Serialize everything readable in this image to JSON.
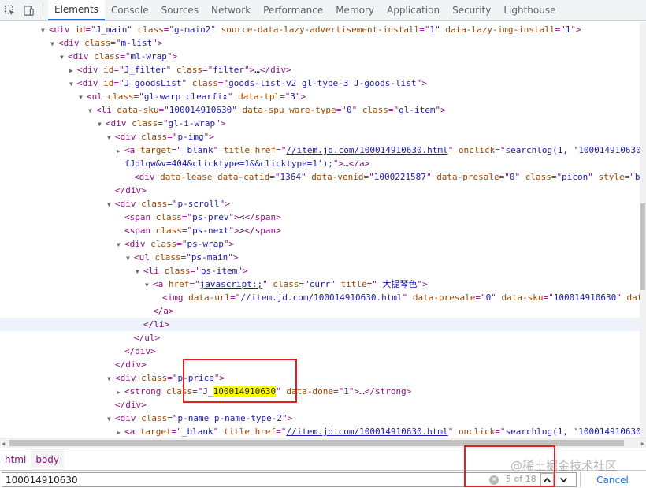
{
  "toolbar": {
    "tabs": [
      "Elements",
      "Console",
      "Sources",
      "Network",
      "Performance",
      "Memory",
      "Application",
      "Security",
      "Lighthouse"
    ],
    "active_tab": "Elements"
  },
  "tree": [
    {
      "indent": 0,
      "tri": "down",
      "segs": [
        [
          "tg",
          "<div "
        ],
        [
          "an",
          "id"
        ],
        [
          "tg",
          "=\""
        ],
        [
          "av",
          "J_main"
        ],
        [
          "tg",
          "\" "
        ],
        [
          "an",
          "class"
        ],
        [
          "tg",
          "=\""
        ],
        [
          "av",
          "g-main2"
        ],
        [
          "tg",
          "\" "
        ],
        [
          "an",
          "source-data-lazy-advertisement-install"
        ],
        [
          "tg",
          "=\""
        ],
        [
          "av",
          "1"
        ],
        [
          "tg",
          "\" "
        ],
        [
          "an",
          "data-lazy-img-install"
        ],
        [
          "tg",
          "=\""
        ],
        [
          "av",
          "1"
        ],
        [
          "tg",
          "\">"
        ]
      ]
    },
    {
      "indent": 1,
      "tri": "down",
      "segs": [
        [
          "tg",
          "<div "
        ],
        [
          "an",
          "class"
        ],
        [
          "tg",
          "=\""
        ],
        [
          "av",
          "m-list"
        ],
        [
          "tg",
          "\">"
        ]
      ]
    },
    {
      "indent": 2,
      "tri": "down",
      "segs": [
        [
          "tg",
          "<div "
        ],
        [
          "an",
          "class"
        ],
        [
          "tg",
          "=\""
        ],
        [
          "av",
          "ml-wrap"
        ],
        [
          "tg",
          "\">"
        ]
      ]
    },
    {
      "indent": 3,
      "tri": "right",
      "segs": [
        [
          "tg",
          "<div "
        ],
        [
          "an",
          "id"
        ],
        [
          "tg",
          "=\""
        ],
        [
          "av",
          "J_filter"
        ],
        [
          "tg",
          "\" "
        ],
        [
          "an",
          "class"
        ],
        [
          "tg",
          "=\""
        ],
        [
          "av",
          "filter"
        ],
        [
          "tg",
          "\">"
        ],
        [
          "txt",
          "…"
        ],
        [
          "tg",
          "</div>"
        ]
      ]
    },
    {
      "indent": 3,
      "tri": "down",
      "segs": [
        [
          "tg",
          "<div "
        ],
        [
          "an",
          "id"
        ],
        [
          "tg",
          "=\""
        ],
        [
          "av",
          "J_goodsList"
        ],
        [
          "tg",
          "\" "
        ],
        [
          "an",
          "class"
        ],
        [
          "tg",
          "=\""
        ],
        [
          "av",
          "goods-list-v2 gl-type-3 J-goods-list"
        ],
        [
          "tg",
          "\">"
        ]
      ]
    },
    {
      "indent": 4,
      "tri": "down",
      "segs": [
        [
          "tg",
          "<ul "
        ],
        [
          "an",
          "class"
        ],
        [
          "tg",
          "=\""
        ],
        [
          "av",
          "gl-warp clearfix"
        ],
        [
          "tg",
          "\" "
        ],
        [
          "an",
          "data-tpl"
        ],
        [
          "tg",
          "=\""
        ],
        [
          "av",
          "3"
        ],
        [
          "tg",
          "\">"
        ]
      ]
    },
    {
      "indent": 5,
      "tri": "down",
      "segs": [
        [
          "tg",
          "<li "
        ],
        [
          "an",
          "data-sku"
        ],
        [
          "tg",
          "=\""
        ],
        [
          "av",
          "100014910630"
        ],
        [
          "tg",
          "\" "
        ],
        [
          "an",
          "data-spu"
        ],
        [
          "tg",
          " "
        ],
        [
          "an",
          "ware-type"
        ],
        [
          "tg",
          "=\""
        ],
        [
          "av",
          "0"
        ],
        [
          "tg",
          "\" "
        ],
        [
          "an",
          "class"
        ],
        [
          "tg",
          "=\""
        ],
        [
          "av",
          "gl-item"
        ],
        [
          "tg",
          "\">"
        ]
      ]
    },
    {
      "indent": 6,
      "tri": "down",
      "segs": [
        [
          "tg",
          "<div "
        ],
        [
          "an",
          "class"
        ],
        [
          "tg",
          "=\""
        ],
        [
          "av",
          "gl-i-wrap"
        ],
        [
          "tg",
          "\">"
        ]
      ]
    },
    {
      "indent": 7,
      "tri": "down",
      "segs": [
        [
          "tg",
          "<div "
        ],
        [
          "an",
          "class"
        ],
        [
          "tg",
          "=\""
        ],
        [
          "av",
          "p-img"
        ],
        [
          "tg",
          "\">"
        ]
      ]
    },
    {
      "indent": 8,
      "tri": "right",
      "segs": [
        [
          "tg",
          "<a "
        ],
        [
          "an",
          "target"
        ],
        [
          "tg",
          "=\""
        ],
        [
          "av",
          "_blank"
        ],
        [
          "tg",
          "\" "
        ],
        [
          "an",
          "title"
        ],
        [
          "tg",
          " "
        ],
        [
          "an",
          "href"
        ],
        [
          "tg",
          "=\""
        ],
        [
          "lnk",
          "//item.jd.com/100014910630.html"
        ],
        [
          "tg",
          "\" "
        ],
        [
          "an",
          "onclick"
        ],
        [
          "tg",
          "=\""
        ],
        [
          "av",
          "searchlog(1, '100014910630"
        ]
      ]
    },
    {
      "indent": 8,
      "tri": "",
      "segs": [
        [
          "av",
          "fJdlqw&v=404&clicktype=1&&clicktype=1');"
        ],
        [
          "tg",
          "\">"
        ],
        [
          "txt",
          "…"
        ],
        [
          "tg",
          "</a>"
        ]
      ]
    },
    {
      "indent": 9,
      "tri": "",
      "segs": [
        [
          "tg",
          "<div "
        ],
        [
          "an",
          "data-lease"
        ],
        [
          "tg",
          " "
        ],
        [
          "an",
          "data-catid"
        ],
        [
          "tg",
          "=\""
        ],
        [
          "av",
          "1364"
        ],
        [
          "tg",
          "\" "
        ],
        [
          "an",
          "data-venid"
        ],
        [
          "tg",
          "=\""
        ],
        [
          "av",
          "1000221587"
        ],
        [
          "tg",
          "\" "
        ],
        [
          "an",
          "data-presale"
        ],
        [
          "tg",
          "=\""
        ],
        [
          "av",
          "0"
        ],
        [
          "tg",
          "\" "
        ],
        [
          "an",
          "class"
        ],
        [
          "tg",
          "=\""
        ],
        [
          "av",
          "picon"
        ],
        [
          "tg",
          "\" "
        ],
        [
          "an",
          "style"
        ],
        [
          "tg",
          "=\""
        ],
        [
          "av",
          "bac"
        ]
      ]
    },
    {
      "indent": 7,
      "tri": "",
      "segs": [
        [
          "tg",
          "</div>"
        ]
      ]
    },
    {
      "indent": 7,
      "tri": "down",
      "segs": [
        [
          "tg",
          "<div "
        ],
        [
          "an",
          "class"
        ],
        [
          "tg",
          "=\""
        ],
        [
          "av",
          "p-scroll"
        ],
        [
          "tg",
          "\">"
        ]
      ]
    },
    {
      "indent": 8,
      "tri": "",
      "segs": [
        [
          "tg",
          "<span "
        ],
        [
          "an",
          "class"
        ],
        [
          "tg",
          "=\""
        ],
        [
          "av",
          "ps-prev"
        ],
        [
          "tg",
          "\">"
        ],
        [
          "txt",
          "<"
        ],
        [
          "tg",
          "</span>"
        ]
      ]
    },
    {
      "indent": 8,
      "tri": "",
      "segs": [
        [
          "tg",
          "<span "
        ],
        [
          "an",
          "class"
        ],
        [
          "tg",
          "=\""
        ],
        [
          "av",
          "ps-next"
        ],
        [
          "tg",
          "\">"
        ],
        [
          "txt",
          ">"
        ],
        [
          "tg",
          "</span>"
        ]
      ]
    },
    {
      "indent": 8,
      "tri": "down",
      "segs": [
        [
          "tg",
          "<div "
        ],
        [
          "an",
          "class"
        ],
        [
          "tg",
          "=\""
        ],
        [
          "av",
          "ps-wrap"
        ],
        [
          "tg",
          "\">"
        ]
      ]
    },
    {
      "indent": 9,
      "tri": "down",
      "segs": [
        [
          "tg",
          "<ul "
        ],
        [
          "an",
          "class"
        ],
        [
          "tg",
          "=\""
        ],
        [
          "av",
          "ps-main"
        ],
        [
          "tg",
          "\">"
        ]
      ]
    },
    {
      "indent": 10,
      "tri": "down",
      "segs": [
        [
          "tg",
          "<li "
        ],
        [
          "an",
          "class"
        ],
        [
          "tg",
          "=\""
        ],
        [
          "av",
          "ps-item"
        ],
        [
          "tg",
          "\">"
        ]
      ]
    },
    {
      "indent": 11,
      "tri": "down",
      "segs": [
        [
          "tg",
          "<a "
        ],
        [
          "an",
          "href"
        ],
        [
          "tg",
          "=\""
        ],
        [
          "lnk",
          "javascript:;"
        ],
        [
          "tg",
          "\" "
        ],
        [
          "an",
          "class"
        ],
        [
          "tg",
          "=\""
        ],
        [
          "av",
          "curr"
        ],
        [
          "tg",
          "\" "
        ],
        [
          "an",
          "title"
        ],
        [
          "tg",
          "=\""
        ],
        [
          "av",
          " 大提琴色"
        ],
        [
          "tg",
          "\">"
        ]
      ]
    },
    {
      "indent": 12,
      "tri": "",
      "segs": [
        [
          "tg",
          "<img "
        ],
        [
          "an",
          "data-url"
        ],
        [
          "tg",
          "=\""
        ],
        [
          "av",
          "//item.jd.com/100014910630.html"
        ],
        [
          "tg",
          "\" "
        ],
        [
          "an",
          "data-presale"
        ],
        [
          "tg",
          "=\""
        ],
        [
          "av",
          "0"
        ],
        [
          "tg",
          "\" "
        ],
        [
          "an",
          "data-sku"
        ],
        [
          "tg",
          "=\""
        ],
        [
          "av",
          "100014910630"
        ],
        [
          "tg",
          "\" "
        ],
        [
          "an",
          "dat"
        ]
      ]
    },
    {
      "indent": 11,
      "tri": "",
      "segs": [
        [
          "tg",
          "</a>"
        ]
      ]
    },
    {
      "indent": 10,
      "tri": "",
      "hl": true,
      "segs": [
        [
          "tg",
          "</li>"
        ]
      ]
    },
    {
      "indent": 9,
      "tri": "",
      "segs": [
        [
          "tg",
          "</ul>"
        ]
      ]
    },
    {
      "indent": 8,
      "tri": "",
      "segs": [
        [
          "tg",
          "</div>"
        ]
      ]
    },
    {
      "indent": 7,
      "tri": "",
      "segs": [
        [
          "tg",
          "</div>"
        ]
      ]
    },
    {
      "indent": 7,
      "tri": "down",
      "segs": [
        [
          "tg",
          "<div "
        ],
        [
          "an",
          "class"
        ],
        [
          "tg",
          "=\""
        ],
        [
          "av",
          "p-price"
        ],
        [
          "tg",
          "\">"
        ]
      ]
    },
    {
      "indent": 8,
      "tri": "right",
      "segs": [
        [
          "tg",
          "<strong "
        ],
        [
          "an",
          "class"
        ],
        [
          "tg",
          "=\""
        ],
        [
          "av",
          "J_"
        ],
        [
          "match",
          "100014910630"
        ],
        [
          "tg",
          "\" "
        ],
        [
          "an",
          "data-done"
        ],
        [
          "tg",
          "=\""
        ],
        [
          "av",
          "1"
        ],
        [
          "tg",
          "\">"
        ],
        [
          "txt",
          "…"
        ],
        [
          "tg",
          "</strong>"
        ]
      ]
    },
    {
      "indent": 7,
      "tri": "",
      "segs": [
        [
          "tg",
          "</div>"
        ]
      ]
    },
    {
      "indent": 7,
      "tri": "down",
      "segs": [
        [
          "tg",
          "<div "
        ],
        [
          "an",
          "class"
        ],
        [
          "tg",
          "=\""
        ],
        [
          "av",
          "p-name p-name-type-2"
        ],
        [
          "tg",
          "\">"
        ]
      ]
    },
    {
      "indent": 8,
      "tri": "right",
      "segs": [
        [
          "tg",
          "<a "
        ],
        [
          "an",
          "target"
        ],
        [
          "tg",
          "=\""
        ],
        [
          "av",
          "_blank"
        ],
        [
          "tg",
          "\" "
        ],
        [
          "an",
          "title"
        ],
        [
          "tg",
          " "
        ],
        [
          "an",
          "href"
        ],
        [
          "tg",
          "=\""
        ],
        [
          "lnk",
          "//item.jd.com/100014910630.html"
        ],
        [
          "tg",
          "\" "
        ],
        [
          "an",
          "onclick"
        ],
        [
          "tg",
          "=\""
        ],
        [
          "av",
          "searchlog(1, '100014910630"
        ]
      ]
    }
  ],
  "breadcrumb": [
    "html",
    "body"
  ],
  "search": {
    "value": "100014910630",
    "match_count": "5 of 18",
    "cancel_label": "Cancel"
  },
  "watermark": "@稀土掘金技术社区"
}
